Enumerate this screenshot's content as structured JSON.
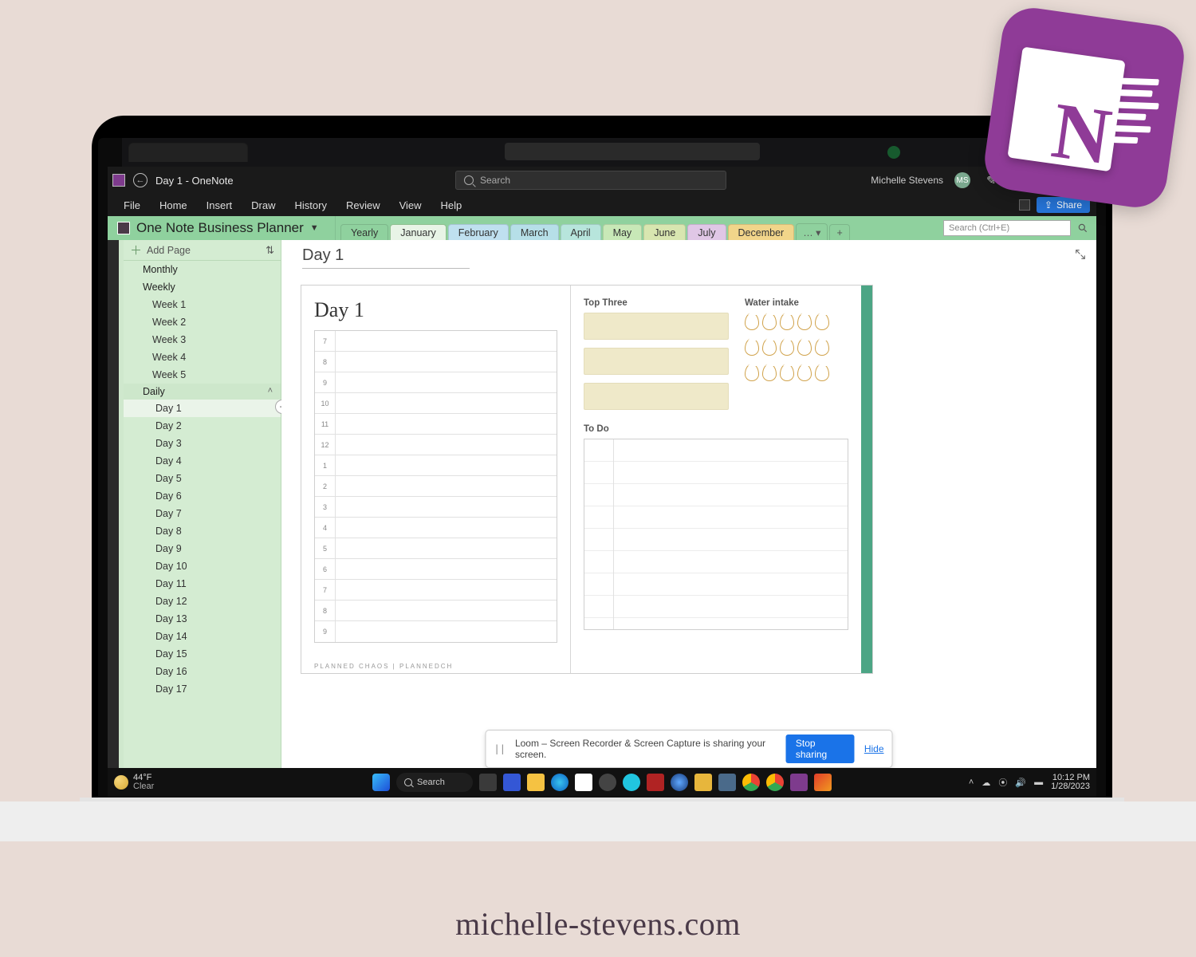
{
  "site_footer": "michelle-stevens.com",
  "titlebar": {
    "doc_title": "Day 1  -  OneNote",
    "search_placeholder": "Search",
    "user_name": "Michelle Stevens",
    "user_initials": "MS"
  },
  "menu": [
    "File",
    "Home",
    "Insert",
    "Draw",
    "History",
    "Review",
    "View",
    "Help"
  ],
  "share_label": "Share",
  "notebook": {
    "name": "One Note Business Planner",
    "tabs": [
      {
        "label": "Yearly",
        "color": "#8fd19e"
      },
      {
        "label": "January",
        "color": "#c9e7c7",
        "active": true
      },
      {
        "label": "February",
        "color": "#bfe0ef"
      },
      {
        "label": "March",
        "color": "#b6dfe8"
      },
      {
        "label": "April",
        "color": "#b7e5dc"
      },
      {
        "label": "May",
        "color": "#c8e8b7"
      },
      {
        "label": "June",
        "color": "#d8e6b0"
      },
      {
        "label": "July",
        "color": "#e0c7e6"
      },
      {
        "label": "December",
        "color": "#f1d58a"
      }
    ],
    "more": "…",
    "search_placeholder": "Search (Ctrl+E)"
  },
  "addpage_label": "Add Page",
  "pages": {
    "top": [
      "Monthly",
      "Weekly"
    ],
    "weeks": [
      "Week 1",
      "Week 2",
      "Week 3",
      "Week 4",
      "Week 5"
    ],
    "daily_label": "Daily",
    "days": [
      "Day 1",
      "Day 2",
      "Day 3",
      "Day 4",
      "Day 5",
      "Day 6",
      "Day 7",
      "Day 8",
      "Day 9",
      "Day 10",
      "Day 11",
      "Day 12",
      "Day 13",
      "Day 14",
      "Day 15",
      "Day 16",
      "Day 17"
    ],
    "selected": "Day 1"
  },
  "canvas": {
    "page_title": "Day 1",
    "day_heading": "Day 1",
    "schedule_hours": [
      "7",
      "8",
      "9",
      "10",
      "11",
      "12",
      "1",
      "2",
      "3",
      "4",
      "5",
      "6",
      "7",
      "8",
      "9"
    ],
    "top_three_label": "Top Three",
    "water_label": "Water intake",
    "todo_label": "To Do",
    "footer_brand": "PLANNED  CHAOS  |  PLANNEDCH"
  },
  "loom": {
    "message": "Loom – Screen Recorder & Screen Capture is sharing your screen.",
    "stop": "Stop sharing",
    "hide": "Hide"
  },
  "taskbar": {
    "temp": "44°F",
    "cond": "Clear",
    "search": "Search",
    "time": "10:12 PM",
    "date": "1/28/2023"
  }
}
